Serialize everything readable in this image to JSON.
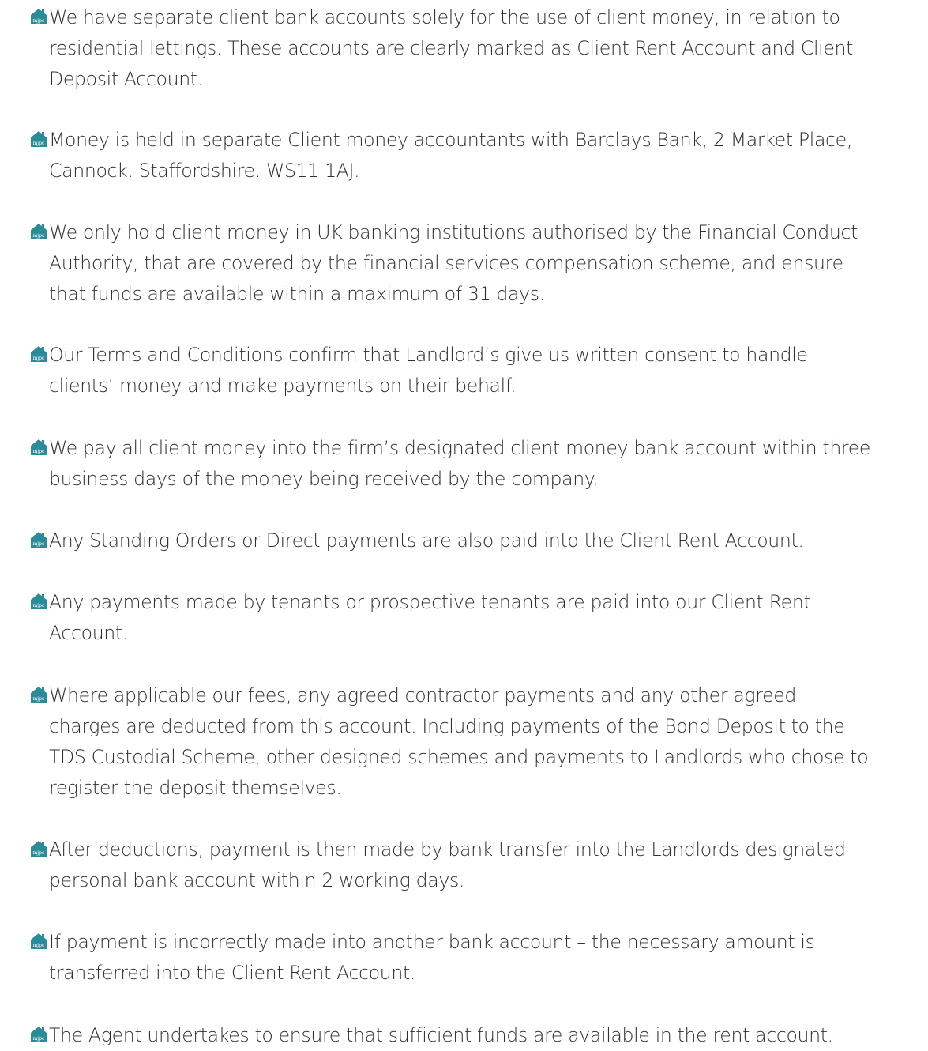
{
  "document": {
    "accent": "#2b8c99",
    "bullet_icon": "house-logo-icon",
    "bullet_logo_text": "mjpc",
    "items": [
      {
        "lines": [
          "We have separate client bank accounts solely for the use of client money, in relation to",
          "residential lettings. These accounts are clearly marked as Client Rent Account and Client",
          "Deposit Account."
        ]
      },
      {
        "lines": [
          "Money is held in separate Client money accountants with Barclays Bank, 2 Market Place,",
          "Cannock. Staffordshire. WS11 1AJ."
        ]
      },
      {
        "lines": [
          "We only hold client money in UK banking institutions authorised by the Financial Conduct",
          "Authority, that are covered by the financial services compensation scheme, and ensure",
          "that funds are available within a maximum of 31 days."
        ]
      },
      {
        "lines": [
          "Our Terms and Conditions confirm that Landlord’s give us written consent to handle",
          "clients’ money and make payments on their behalf."
        ]
      },
      {
        "lines": [
          "We pay all client money into the firm’s designated client money bank account within three",
          "business days of the money being received by the company."
        ]
      },
      {
        "lines": [
          "Any Standing Orders or Direct payments are also paid into the Client Rent Account."
        ]
      },
      {
        "lines": [
          "Any payments made by tenants or prospective tenants are paid into our Client Rent",
          "Account."
        ]
      },
      {
        "lines": [
          "Where applicable our fees, any agreed contractor payments and any other agreed",
          "charges are deducted from this account.  Including payments of the Bond Deposit to the",
          "TDS Custodial Scheme, other designed schemes and payments to Landlords who chose to",
          "register the deposit themselves."
        ]
      },
      {
        "lines": [
          "After deductions, payment is then made by bank transfer into the Landlords designated",
          "personal bank account within 2 working days."
        ]
      },
      {
        "lines": [
          "If payment is incorrectly made into another bank account – the necessary amount is",
          "transferred into the Client Rent Account."
        ]
      },
      {
        "lines": [
          "The Agent undertakes to ensure that sufficient funds are available in the rent account."
        ]
      }
    ]
  }
}
